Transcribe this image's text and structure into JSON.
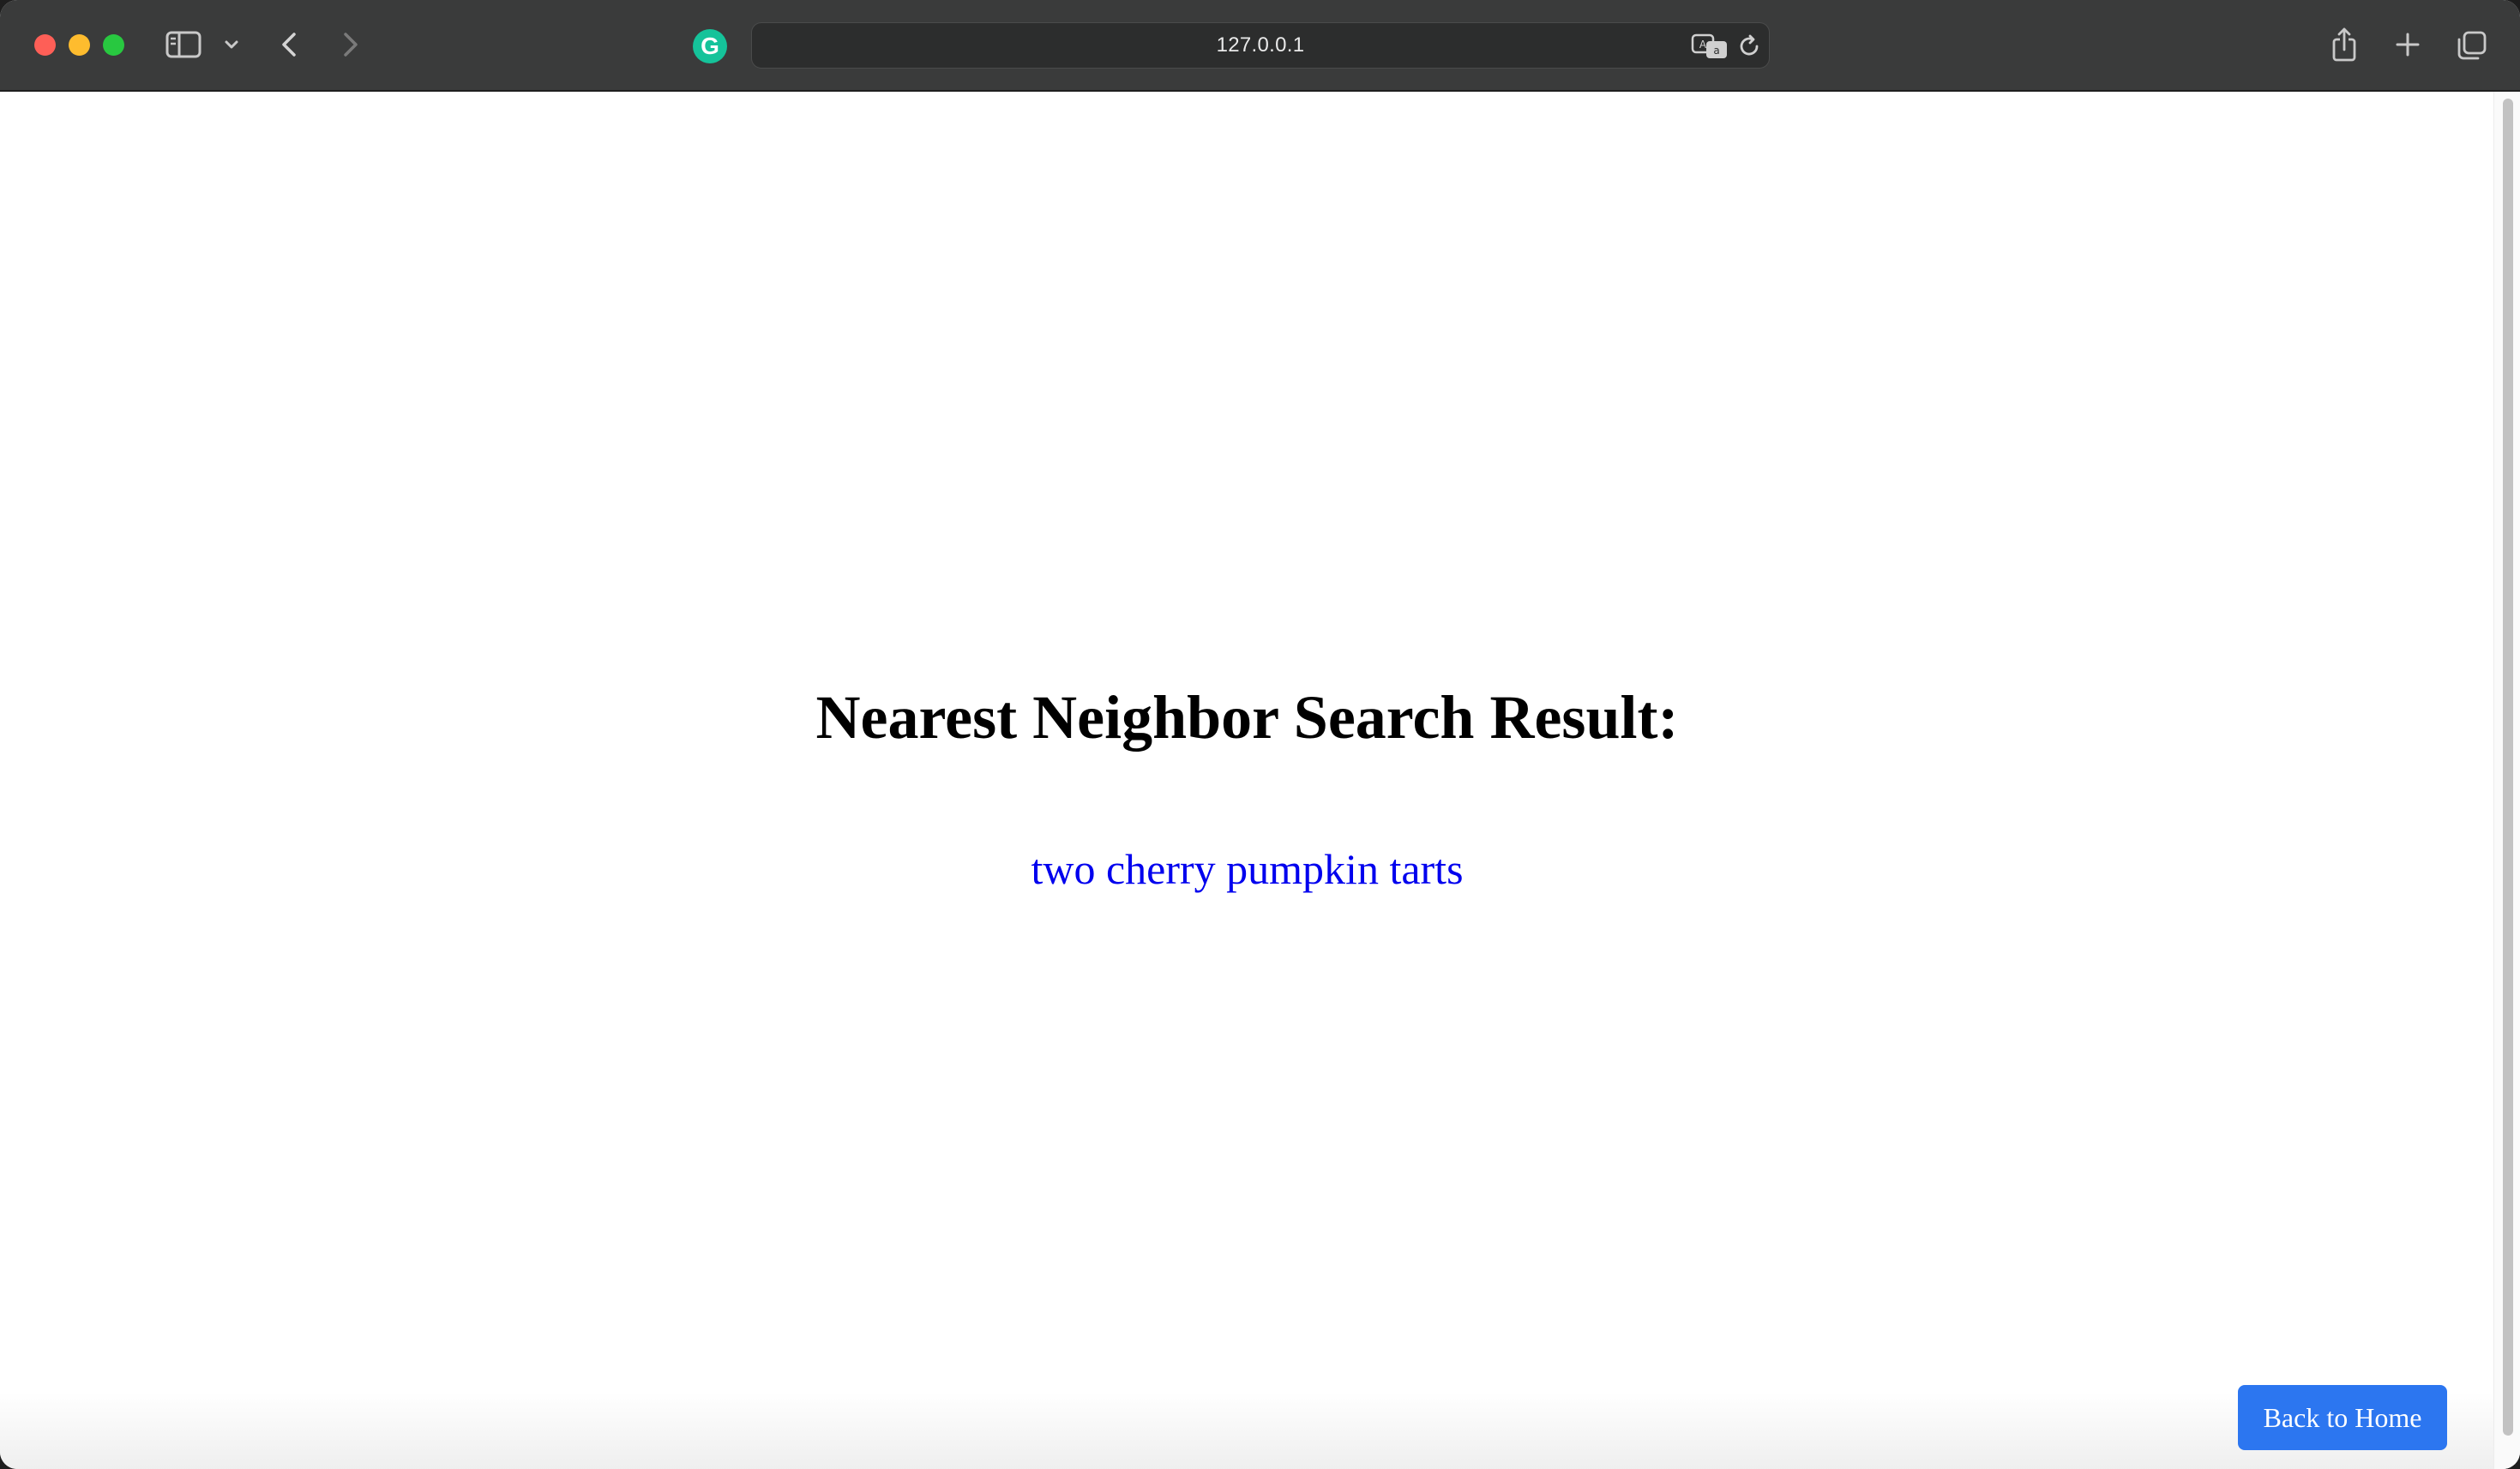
{
  "browser": {
    "address": "127.0.0.1",
    "extension_icon": "grammarly-icon",
    "extension_letter": "G",
    "colors": {
      "toolbar": "#3a3b3b",
      "close": "#fe5f57",
      "minimize": "#febc2e",
      "maximize": "#28c840",
      "grammarly": "#15c39a"
    }
  },
  "page": {
    "title": "Nearest Neighbor Search Result:",
    "result": "two cherry pumpkin tarts",
    "home_button_label": "Back to Home",
    "colors": {
      "result_text": "#0000ee",
      "button_bg": "#2c76f0"
    }
  }
}
